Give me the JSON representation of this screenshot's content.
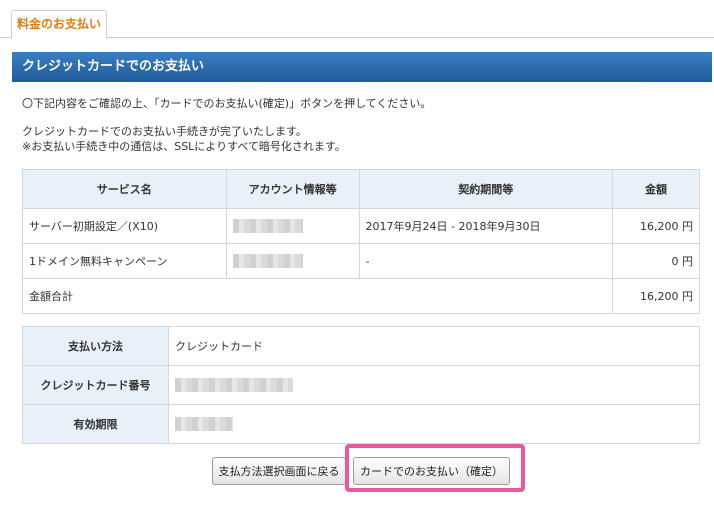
{
  "tab": {
    "label": "料金のお支払い"
  },
  "section": {
    "title": "クレジットカードでのお支払い"
  },
  "intro": {
    "line1": "〇下記内容をご確認の上、「カードでのお支払い(確定)」ボタンを押してください。",
    "line2": "クレジットカードでのお支払い手続きが完了いたします。",
    "line3": "※お支払い手続き中の通信は、SSLによりすべて暗号化されます。"
  },
  "order_table": {
    "headers": [
      "サービス名",
      "アカウント情報等",
      "契約期間等",
      "金額"
    ],
    "rows": [
      {
        "service": "サーバー初期設定／(X10)",
        "period": "2017年9月24日 - 2018年9月30日",
        "amount": "16,200 円"
      },
      {
        "service": "1ドメイン無料キャンペーン",
        "period": "-",
        "amount": "0 円"
      }
    ],
    "total_label": "金額合計",
    "total_amount": "16,200 円"
  },
  "payment_table": {
    "method_label": "支払い方法",
    "method_value": "クレジットカード",
    "card_number_label": "クレジットカード番号",
    "expiry_label": "有効期限"
  },
  "buttons": {
    "back": "支払方法選択画面に戻る",
    "confirm": "カードでのお支払い（確定）"
  },
  "colors": {
    "accent": "#e07b12",
    "titlebar": "#2a6aab",
    "highlight": "#e85a9c",
    "header_bg": "#e9f0f7"
  }
}
